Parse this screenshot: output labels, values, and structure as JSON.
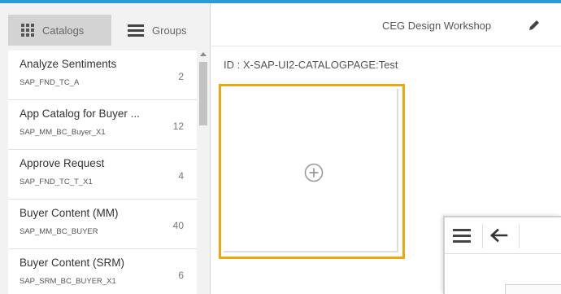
{
  "header": {
    "title": "CEG Design Workshop",
    "edit_icon": "pencil-icon"
  },
  "sidebar": {
    "tabs": [
      {
        "label": "Catalogs",
        "icon": "grid-icon",
        "active": true
      },
      {
        "label": "Groups",
        "icon": "menu-icon",
        "active": false
      }
    ],
    "items": [
      {
        "title": "Analyze Sentiments",
        "id": "SAP_FND_TC_A",
        "count": "2"
      },
      {
        "title": "App Catalog for Buyer ...",
        "id": "SAP_MM_BC_Buyer_X1",
        "count": "12"
      },
      {
        "title": "Approve Request",
        "id": "SAP_FND_TC_T_X1",
        "count": "4"
      },
      {
        "title": "Buyer Content (MM)",
        "id": "SAP_MM_BC_BUYER",
        "count": "40"
      },
      {
        "title": "Buyer Content (SRM)",
        "id": "SAP_SRM_BC_BUYER_X1",
        "count": "6"
      }
    ]
  },
  "main": {
    "page_id": "ID : X-SAP-UI2-CATALOGPAGE:Test",
    "add_tile_icon": "plus-circle-icon"
  },
  "overlay": {
    "menu_icon": "hamburger-icon",
    "back_icon": "arrow-left-icon"
  },
  "colors": {
    "accent_top": "#2b9bd3",
    "tile_highlight": "#f2a60c",
    "active_tab": "#d3d3d3"
  }
}
